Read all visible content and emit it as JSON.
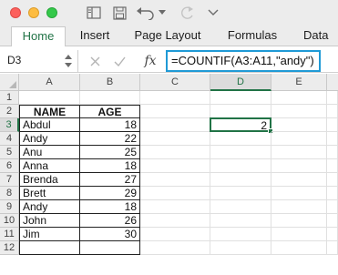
{
  "toolbar": {
    "icons": [
      "sidebar-icon",
      "save-icon",
      "undo-icon",
      "undo-dropdown-icon",
      "redo-icon",
      "customize-dropdown-icon"
    ]
  },
  "ribbon": {
    "tabs": [
      {
        "label": "Home",
        "active": true
      },
      {
        "label": "Insert",
        "active": false
      },
      {
        "label": "Page Layout",
        "active": false
      },
      {
        "label": "Formulas",
        "active": false
      },
      {
        "label": "Data",
        "active": false
      }
    ]
  },
  "formula_bar": {
    "name_box": "D3",
    "fx_label": "fx",
    "formula": "=COUNTIF(A3:A11,\"andy\")"
  },
  "sheet": {
    "columns": [
      "A",
      "B",
      "C",
      "D",
      "E"
    ],
    "selected_column": "D",
    "selected_row": "3",
    "rows": [
      "1",
      "2",
      "3",
      "4",
      "5",
      "6",
      "7",
      "8",
      "9",
      "10",
      "11",
      "12"
    ],
    "table": {
      "headers": [
        "NAME",
        "AGE"
      ],
      "records": [
        {
          "name": "Abdul",
          "age": "18"
        },
        {
          "name": "Andy",
          "age": "22"
        },
        {
          "name": "Anu",
          "age": "25"
        },
        {
          "name": "Anna",
          "age": "18"
        },
        {
          "name": "Brenda",
          "age": "27"
        },
        {
          "name": "Brett",
          "age": "29"
        },
        {
          "name": "Andy",
          "age": "18"
        },
        {
          "name": "John",
          "age": "26"
        },
        {
          "name": "Jim",
          "age": "30"
        }
      ]
    },
    "active_cell_value": "2"
  },
  "colors": {
    "accent": "#217346",
    "formula_border": "#1f9ad6"
  }
}
